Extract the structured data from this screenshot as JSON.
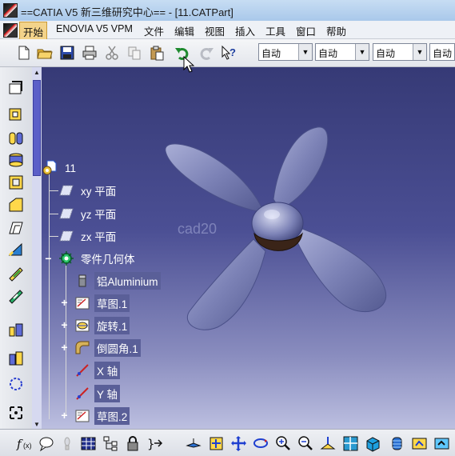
{
  "window": {
    "title": "==CATIA V5  新三维研究中心== - [11.CATPart]"
  },
  "menu": [
    {
      "label": "开始",
      "active": true
    },
    {
      "label": "ENOVIA V5 VPM"
    },
    {
      "label": "文件"
    },
    {
      "label": "编辑"
    },
    {
      "label": "视图"
    },
    {
      "label": "插入"
    },
    {
      "label": "工具"
    },
    {
      "label": "窗口"
    },
    {
      "label": "帮助"
    }
  ],
  "toolbar": {
    "combos": [
      "自动",
      "自动",
      "自动",
      "自动"
    ]
  },
  "tree": {
    "root": "11",
    "planes": [
      "xy 平面",
      "yz 平面",
      "zx 平面"
    ],
    "body": "零件几何体",
    "material": "铝Aluminium",
    "features": [
      "草图.1",
      "旋转.1",
      "倒圆角.1",
      "X 轴",
      "Y 轴",
      "草图.2"
    ]
  },
  "viewport": {
    "watermark": "cad20"
  },
  "colors": {
    "viewport_top": "#363a76",
    "viewport_bottom": "#bcbfe0",
    "propeller": "#8e94c2",
    "hub_dark": "#3a2418"
  }
}
